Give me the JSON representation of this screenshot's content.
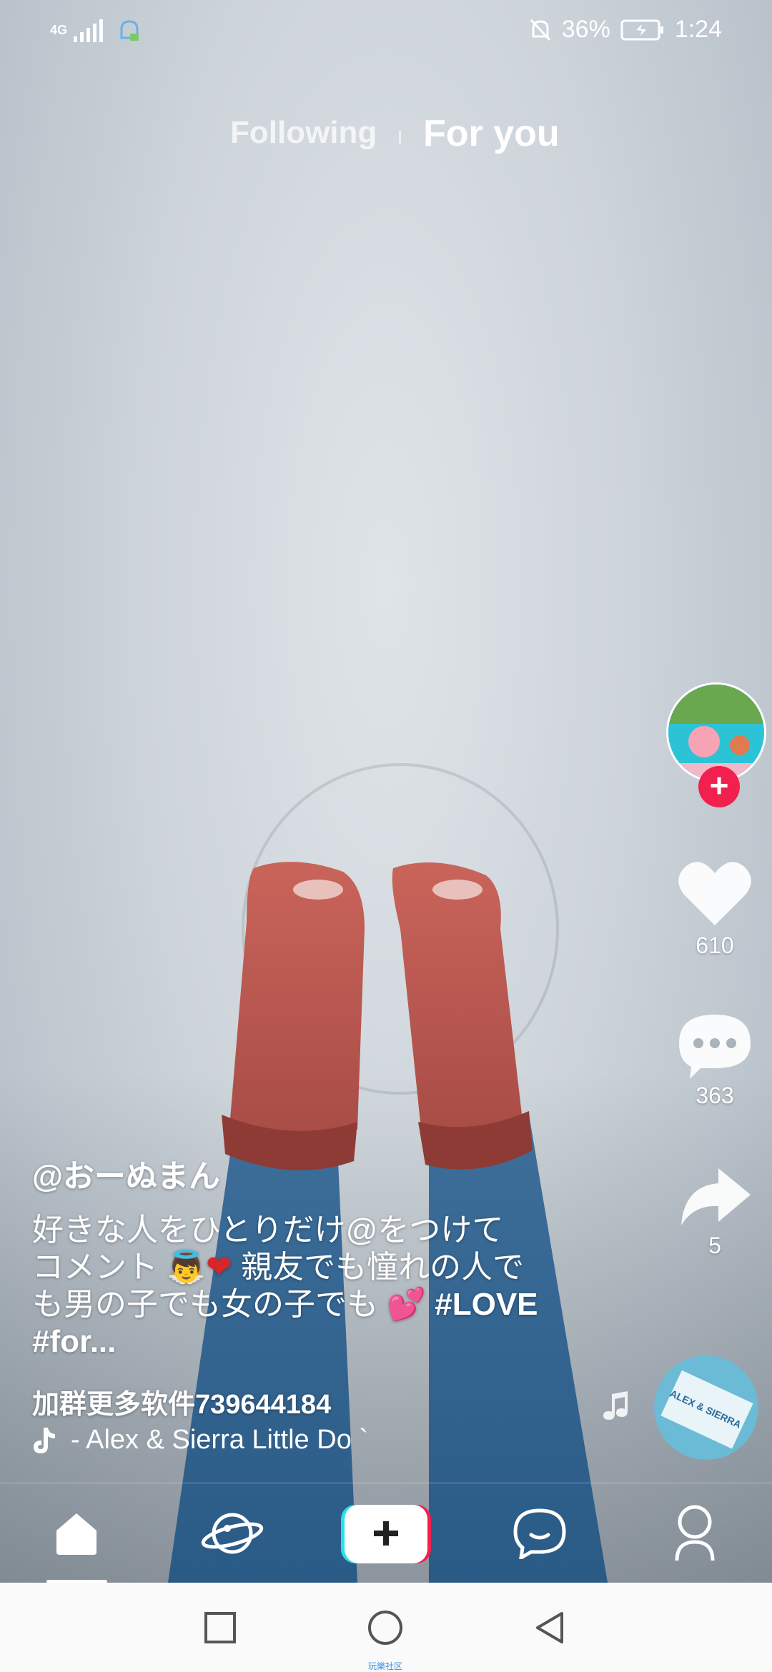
{
  "status_bar": {
    "network": "4G",
    "battery": "36%",
    "time": "1:24"
  },
  "top_nav": {
    "following": "Following",
    "for_you": "For you"
  },
  "rail": {
    "likes": "610",
    "comments": "363",
    "shares": "5"
  },
  "caption": {
    "username": "@おーぬまん",
    "line1": "好きな人をひとりだけ@をつけて",
    "line2a": "コメント",
    "line2b": " 親友でも憧れの人で",
    "line3a": "も男の子でも女の子でも",
    "hashtag1": " #LOVE",
    "line4": "#for...",
    "promo": "加群更多软件739644184"
  },
  "music": {
    "text": "- Alex & Sierra    Little Do `"
  },
  "disc_label": "ALEX & SIERRA",
  "system_nav": {
    "watermark": "玩樂社区"
  },
  "colors": {
    "accent": "#f1204f",
    "create_left": "#2ce0e6",
    "create_right": "#f1204f"
  }
}
